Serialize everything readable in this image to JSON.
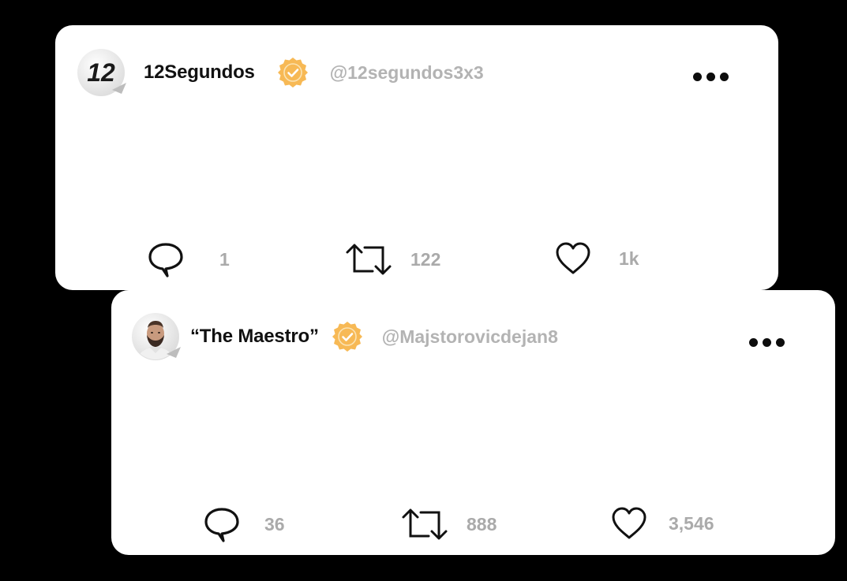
{
  "colors": {
    "background": "#000000",
    "card": "#ffffff",
    "verified_badge": "#f7b955",
    "handle_text": "#b3b3b3",
    "count_text": "#aaaaaa",
    "name_text": "#111111"
  },
  "posts": [
    {
      "avatar_icon": "12segundos-logo-icon",
      "display_name": "12Segundos",
      "verified_icon": "verified-badge-icon",
      "handle": "@12segundos3x3",
      "more_icon": "more-dots-icon",
      "stats": {
        "replies": "1",
        "retweets": "122",
        "likes": "1k"
      }
    },
    {
      "avatar_icon": "profile-photo-avatar",
      "display_name": "“The Maestro”",
      "verified_icon": "verified-badge-icon",
      "handle": "@Majstorovicdejan8",
      "more_icon": "more-dots-icon",
      "stats": {
        "replies": "36",
        "retweets": "888",
        "likes": "3,546"
      }
    }
  ]
}
